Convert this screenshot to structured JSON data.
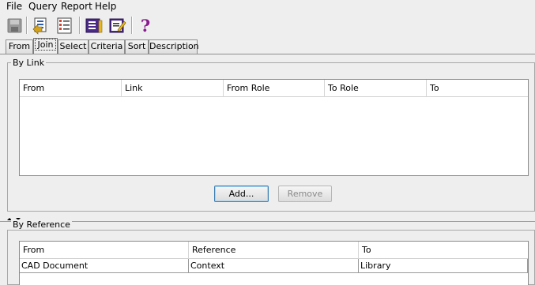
{
  "menu": [
    "File",
    "Query",
    "Report",
    "Help"
  ],
  "toolbar": {
    "icons": [
      "save-icon",
      "open-query-icon",
      "query-list-icon",
      "report-icon",
      "edit-report-icon",
      "help-icon"
    ],
    "help_glyph": "?"
  },
  "tabs": [
    {
      "label": "From",
      "active": false
    },
    {
      "label": "Join",
      "active": true
    },
    {
      "label": "Select",
      "active": false
    },
    {
      "label": "Criteria",
      "active": false
    },
    {
      "label": "Sort",
      "active": false
    },
    {
      "label": "Description",
      "active": false
    }
  ],
  "by_link": {
    "title": "By Link",
    "columns": [
      "From",
      "Link",
      "From Role",
      "To Role",
      "To"
    ],
    "rows": [],
    "add_label": "Add...",
    "remove_label": "Remove"
  },
  "by_reference": {
    "title": "By Reference",
    "columns": [
      "From",
      "Reference",
      "To"
    ],
    "rows": [
      [
        "CAD Document",
        "Context",
        "Library"
      ]
    ]
  },
  "colors": {
    "background": "#eeeeee",
    "accent": "#3c7fb1",
    "help": "#8a1a8f"
  }
}
